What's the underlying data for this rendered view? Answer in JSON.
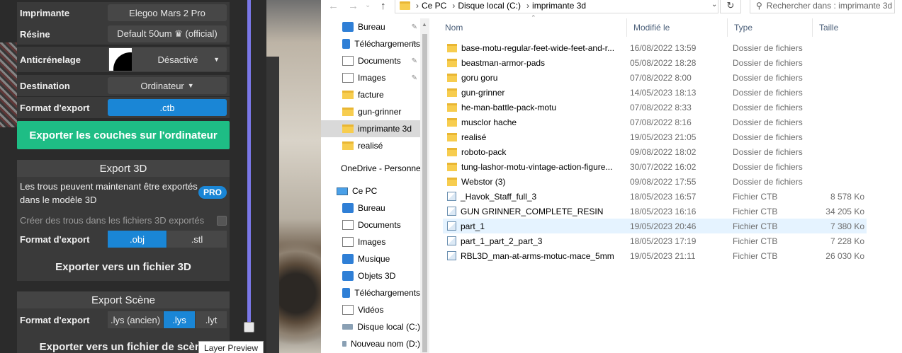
{
  "slicer": {
    "printer_label": "Imprimante",
    "printer_value": "Elegoo Mars 2 Pro",
    "resin_label": "Résine",
    "resin_value": "Default 50um ♛ (official)",
    "aa_label": "Anticrénelage",
    "aa_value": "Désactivé",
    "dest_label": "Destination",
    "dest_value": "Ordinateur",
    "format_label": "Format d'export",
    "format_value": ".ctb",
    "export_layers_button": "Exporter les couches sur l'ordinateur",
    "export3d": {
      "title": "Export 3D",
      "holes_text_1": "Les trous peuvent maintenant être exportés",
      "holes_text_2": "dans le modèle 3D",
      "pro_badge": "PRO",
      "create_holes_label": "Créer des trous dans les fichiers 3D exportés",
      "format_label": "Format d'export",
      "options": [
        ".obj",
        ".stl"
      ],
      "selected": ".obj",
      "button": "Exporter vers un fichier 3D"
    },
    "export_scene": {
      "title": "Export Scène",
      "format_label": "Format d'export",
      "options": [
        ".lys (ancien)",
        ".lys",
        ".lyt"
      ],
      "selected": ".lys",
      "button": "Exporter vers un fichier de scène"
    },
    "tooltip": "Layer Preview",
    "accent_color": "#1a86d6",
    "button_color": "#1ebd85",
    "slider_color": "#7b78e8"
  },
  "explorer": {
    "breadcrumb": [
      "Ce PC",
      "Disque local (C:)",
      "imprimante 3d"
    ],
    "search_placeholder": "Rechercher dans : imprimante 3d",
    "nav": [
      {
        "label": "Bureau",
        "icon": "desktop-icon",
        "pinned": true
      },
      {
        "label": "Téléchargements",
        "icon": "download-icon",
        "pinned": true
      },
      {
        "label": "Documents",
        "icon": "documents-icon",
        "pinned": true
      },
      {
        "label": "Images",
        "icon": "images-icon",
        "pinned": true
      },
      {
        "label": "facture",
        "icon": "folder-icon",
        "pinned": false
      },
      {
        "label": "gun-grinner",
        "icon": "folder-icon",
        "pinned": false
      },
      {
        "label": "imprimante 3d",
        "icon": "folder-icon",
        "pinned": false,
        "selected": true
      },
      {
        "label": "realisé",
        "icon": "folder-icon",
        "pinned": false
      },
      {
        "label": "OneDrive - Personnel",
        "icon": "onedrive-icon",
        "pinned": false
      },
      {
        "label": "Ce PC",
        "icon": "this-pc-icon",
        "pinned": false
      },
      {
        "label": "Bureau",
        "icon": "desktop-icon",
        "pinned": false
      },
      {
        "label": "Documents",
        "icon": "documents-icon",
        "pinned": false
      },
      {
        "label": "Images",
        "icon": "images-icon",
        "pinned": false
      },
      {
        "label": "Musique",
        "icon": "music-icon",
        "pinned": false
      },
      {
        "label": "Objets 3D",
        "icon": "objects-3d-icon",
        "pinned": false
      },
      {
        "label": "Téléchargements",
        "icon": "download-icon",
        "pinned": false
      },
      {
        "label": "Vidéos",
        "icon": "videos-icon",
        "pinned": false
      },
      {
        "label": "Disque local (C:)",
        "icon": "drive-icon",
        "pinned": false
      },
      {
        "label": "Nouveau nom (D:)",
        "icon": "drive-icon",
        "pinned": false
      }
    ],
    "columns": {
      "name": "Nom",
      "date": "Modifié le",
      "type": "Type",
      "size": "Taille"
    },
    "files": [
      {
        "name": "base-motu-regular-feet-wide-feet-and-r...",
        "date": "16/08/2022 13:59",
        "type": "Dossier de fichiers",
        "size": "",
        "kind": "folder"
      },
      {
        "name": "beastman-armor-pads",
        "date": "05/08/2022 18:28",
        "type": "Dossier de fichiers",
        "size": "",
        "kind": "folder"
      },
      {
        "name": "goru goru",
        "date": "07/08/2022 8:00",
        "type": "Dossier de fichiers",
        "size": "",
        "kind": "folder"
      },
      {
        "name": "gun-grinner",
        "date": "14/05/2023 18:13",
        "type": "Dossier de fichiers",
        "size": "",
        "kind": "folder"
      },
      {
        "name": "he-man-battle-pack-motu",
        "date": "07/08/2022 8:33",
        "type": "Dossier de fichiers",
        "size": "",
        "kind": "folder"
      },
      {
        "name": "musclor hache",
        "date": "07/08/2022 8:16",
        "type": "Dossier de fichiers",
        "size": "",
        "kind": "folder"
      },
      {
        "name": "realisé",
        "date": "19/05/2023 21:05",
        "type": "Dossier de fichiers",
        "size": "",
        "kind": "folder"
      },
      {
        "name": "roboto-pack",
        "date": "09/08/2022 18:02",
        "type": "Dossier de fichiers",
        "size": "",
        "kind": "folder"
      },
      {
        "name": "tung-lashor-motu-vintage-action-figure...",
        "date": "30/07/2022 16:02",
        "type": "Dossier de fichiers",
        "size": "",
        "kind": "folder"
      },
      {
        "name": "Webstor (3)",
        "date": "09/08/2022 17:55",
        "type": "Dossier de fichiers",
        "size": "",
        "kind": "folder"
      },
      {
        "name": "_Havok_Staff_full_3",
        "date": "18/05/2023 16:57",
        "type": "Fichier CTB",
        "size": "8 578 Ko",
        "kind": "file"
      },
      {
        "name": "GUN GRINNER_COMPLETE_RESIN",
        "date": "18/05/2023 16:16",
        "type": "Fichier CTB",
        "size": "34 205 Ko",
        "kind": "file"
      },
      {
        "name": "part_1",
        "date": "19/05/2023 20:46",
        "type": "Fichier CTB",
        "size": "7 380 Ko",
        "kind": "file",
        "selected": true
      },
      {
        "name": "part_1_part_2_part_3",
        "date": "18/05/2023 17:19",
        "type": "Fichier CTB",
        "size": "7 228 Ko",
        "kind": "file"
      },
      {
        "name": "RBL3D_man-at-arms-motuc-mace_5mm",
        "date": "19/05/2023 21:11",
        "type": "Fichier CTB",
        "size": "26 030 Ko",
        "kind": "file"
      }
    ]
  }
}
